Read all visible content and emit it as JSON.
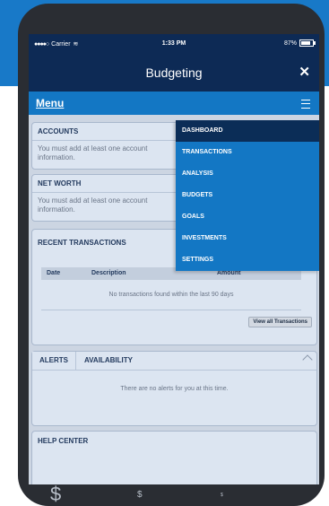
{
  "status": {
    "carrier": "Carrier",
    "time": "1:33 PM",
    "battery": "87%",
    "battery_level": 0.87
  },
  "header": {
    "title": "Budgeting",
    "close": "✕"
  },
  "menubar": {
    "label": "Menu"
  },
  "accounts": {
    "title": "ACCOUNTS",
    "message": "You must add at least one account information."
  },
  "networth": {
    "title": "NET WORTH",
    "message": "You must add at least one account information."
  },
  "recent": {
    "title": "RECENT TRANSACTIONS",
    "columns": [
      "Date",
      "Description",
      "Amount"
    ],
    "empty": "No transactions found within the last 90 days",
    "view_all": "View all Transactions"
  },
  "alerts": {
    "tabs": [
      "ALERTS",
      "AVAILABILITY"
    ],
    "message": "There are no alerts for you at this time."
  },
  "help": {
    "title": "HELP CENTER"
  },
  "menu_items": [
    "DASHBOARD",
    "TRANSACTIONS",
    "ANALYSIS",
    "BUDGETS",
    "GOALS",
    "INVESTMENTS",
    "SETTINGS"
  ],
  "footer_symbols": [
    "$",
    "$",
    "$"
  ],
  "colors": {
    "brand_blue": "#1377c4",
    "dark_navy": "#0b2d57"
  }
}
